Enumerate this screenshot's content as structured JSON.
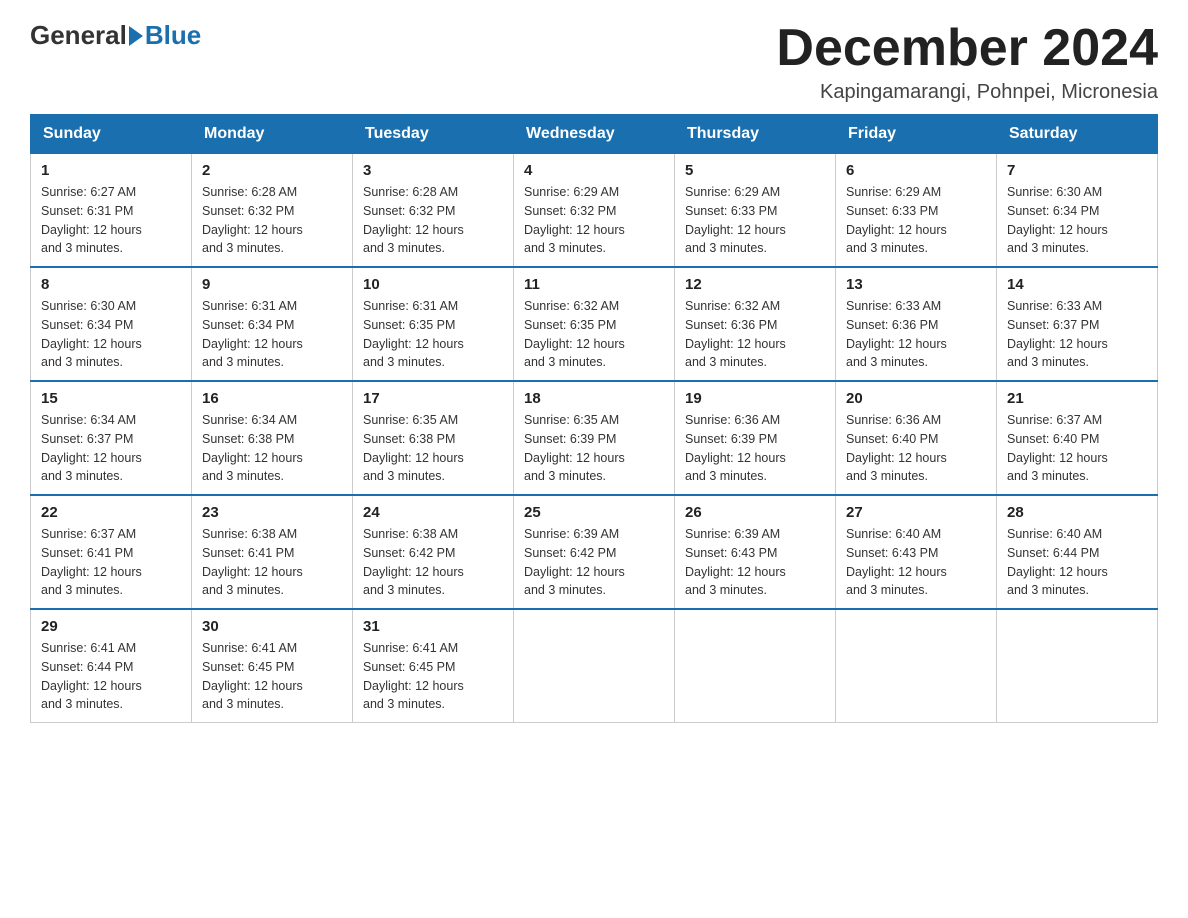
{
  "logo": {
    "general": "General",
    "blue": "Blue"
  },
  "title": "December 2024",
  "location": "Kapingamarangi, Pohnpei, Micronesia",
  "headers": [
    "Sunday",
    "Monday",
    "Tuesday",
    "Wednesday",
    "Thursday",
    "Friday",
    "Saturday"
  ],
  "weeks": [
    [
      {
        "day": "1",
        "sunrise": "6:27 AM",
        "sunset": "6:31 PM",
        "daylight": "12 hours and 3 minutes."
      },
      {
        "day": "2",
        "sunrise": "6:28 AM",
        "sunset": "6:32 PM",
        "daylight": "12 hours and 3 minutes."
      },
      {
        "day": "3",
        "sunrise": "6:28 AM",
        "sunset": "6:32 PM",
        "daylight": "12 hours and 3 minutes."
      },
      {
        "day": "4",
        "sunrise": "6:29 AM",
        "sunset": "6:32 PM",
        "daylight": "12 hours and 3 minutes."
      },
      {
        "day": "5",
        "sunrise": "6:29 AM",
        "sunset": "6:33 PM",
        "daylight": "12 hours and 3 minutes."
      },
      {
        "day": "6",
        "sunrise": "6:29 AM",
        "sunset": "6:33 PM",
        "daylight": "12 hours and 3 minutes."
      },
      {
        "day": "7",
        "sunrise": "6:30 AM",
        "sunset": "6:34 PM",
        "daylight": "12 hours and 3 minutes."
      }
    ],
    [
      {
        "day": "8",
        "sunrise": "6:30 AM",
        "sunset": "6:34 PM",
        "daylight": "12 hours and 3 minutes."
      },
      {
        "day": "9",
        "sunrise": "6:31 AM",
        "sunset": "6:34 PM",
        "daylight": "12 hours and 3 minutes."
      },
      {
        "day": "10",
        "sunrise": "6:31 AM",
        "sunset": "6:35 PM",
        "daylight": "12 hours and 3 minutes."
      },
      {
        "day": "11",
        "sunrise": "6:32 AM",
        "sunset": "6:35 PM",
        "daylight": "12 hours and 3 minutes."
      },
      {
        "day": "12",
        "sunrise": "6:32 AM",
        "sunset": "6:36 PM",
        "daylight": "12 hours and 3 minutes."
      },
      {
        "day": "13",
        "sunrise": "6:33 AM",
        "sunset": "6:36 PM",
        "daylight": "12 hours and 3 minutes."
      },
      {
        "day": "14",
        "sunrise": "6:33 AM",
        "sunset": "6:37 PM",
        "daylight": "12 hours and 3 minutes."
      }
    ],
    [
      {
        "day": "15",
        "sunrise": "6:34 AM",
        "sunset": "6:37 PM",
        "daylight": "12 hours and 3 minutes."
      },
      {
        "day": "16",
        "sunrise": "6:34 AM",
        "sunset": "6:38 PM",
        "daylight": "12 hours and 3 minutes."
      },
      {
        "day": "17",
        "sunrise": "6:35 AM",
        "sunset": "6:38 PM",
        "daylight": "12 hours and 3 minutes."
      },
      {
        "day": "18",
        "sunrise": "6:35 AM",
        "sunset": "6:39 PM",
        "daylight": "12 hours and 3 minutes."
      },
      {
        "day": "19",
        "sunrise": "6:36 AM",
        "sunset": "6:39 PM",
        "daylight": "12 hours and 3 minutes."
      },
      {
        "day": "20",
        "sunrise": "6:36 AM",
        "sunset": "6:40 PM",
        "daylight": "12 hours and 3 minutes."
      },
      {
        "day": "21",
        "sunrise": "6:37 AM",
        "sunset": "6:40 PM",
        "daylight": "12 hours and 3 minutes."
      }
    ],
    [
      {
        "day": "22",
        "sunrise": "6:37 AM",
        "sunset": "6:41 PM",
        "daylight": "12 hours and 3 minutes."
      },
      {
        "day": "23",
        "sunrise": "6:38 AM",
        "sunset": "6:41 PM",
        "daylight": "12 hours and 3 minutes."
      },
      {
        "day": "24",
        "sunrise": "6:38 AM",
        "sunset": "6:42 PM",
        "daylight": "12 hours and 3 minutes."
      },
      {
        "day": "25",
        "sunrise": "6:39 AM",
        "sunset": "6:42 PM",
        "daylight": "12 hours and 3 minutes."
      },
      {
        "day": "26",
        "sunrise": "6:39 AM",
        "sunset": "6:43 PM",
        "daylight": "12 hours and 3 minutes."
      },
      {
        "day": "27",
        "sunrise": "6:40 AM",
        "sunset": "6:43 PM",
        "daylight": "12 hours and 3 minutes."
      },
      {
        "day": "28",
        "sunrise": "6:40 AM",
        "sunset": "6:44 PM",
        "daylight": "12 hours and 3 minutes."
      }
    ],
    [
      {
        "day": "29",
        "sunrise": "6:41 AM",
        "sunset": "6:44 PM",
        "daylight": "12 hours and 3 minutes."
      },
      {
        "day": "30",
        "sunrise": "6:41 AM",
        "sunset": "6:45 PM",
        "daylight": "12 hours and 3 minutes."
      },
      {
        "day": "31",
        "sunrise": "6:41 AM",
        "sunset": "6:45 PM",
        "daylight": "12 hours and 3 minutes."
      },
      null,
      null,
      null,
      null
    ]
  ]
}
